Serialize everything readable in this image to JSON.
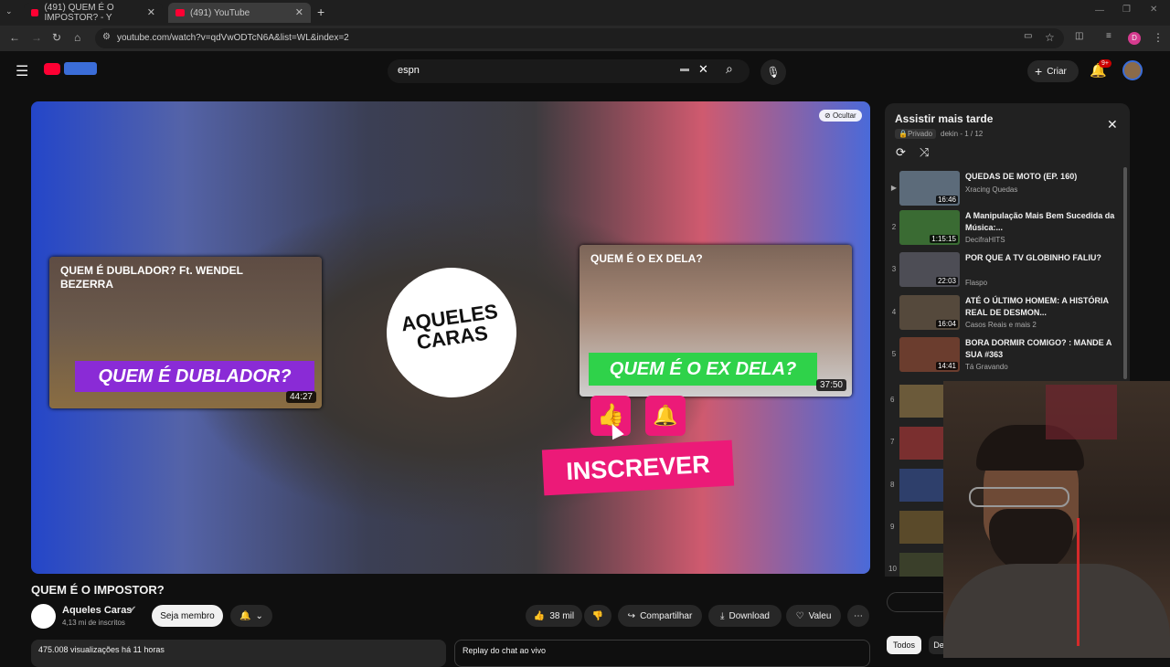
{
  "browser": {
    "tabs": [
      {
        "label": "(491) QUEM É O IMPOSTOR? - Y"
      },
      {
        "label": "(491) YouTube"
      }
    ],
    "url": "youtube.com/watch?v=qdVwODTcN6A&list=WL&index=2"
  },
  "header": {
    "search_value": "espn",
    "create_label": "Criar",
    "notification_badge": "9+",
    "profile_initial": "D"
  },
  "video": {
    "hide_label": "Ocultar",
    "endcards": [
      {
        "title": "QUEM É DUBLADOR? Ft. WENDEL BEZERRA",
        "banner": "QUEM É DUBLADOR?",
        "duration": "44:27"
      },
      {
        "title": "QUEM É O EX DELA?",
        "banner": "QUEM É O EX DELA?",
        "duration": "37:50"
      }
    ],
    "channel_logo_text": "AQUELES CARAS",
    "subscribe_overlay": "INSCREVER",
    "title": "QUEM É O IMPOSTOR?"
  },
  "channel": {
    "name": "Aqueles Caras",
    "subs": "4,13 mi de inscritos",
    "join_label": "Seja membro"
  },
  "actions": {
    "likes": "38 mil",
    "share": "Compartilhar",
    "download": "Download",
    "thanks": "Valeu"
  },
  "meta": {
    "views": "475.008 visualizações  há 11 horas",
    "chat_replay": "Replay do chat ao vivo"
  },
  "playlist": {
    "title": "Assistir mais tarde",
    "privacy": "Privado",
    "owner_pos": "dekin - 1 / 12",
    "items": [
      {
        "num": "▶",
        "title": "QUEDAS DE MOTO (EP. 160)",
        "channel": "Xracing Quedas",
        "duration": "16:46",
        "color": "#5c6b7a"
      },
      {
        "num": "2",
        "title": "A Manipulação Mais Bem Sucedida da Música:...",
        "channel": "DecifraHITS",
        "duration": "1:15:15",
        "color": "#3a6b33"
      },
      {
        "num": "3",
        "title": "POR QUE A TV GLOBINHO FALIU?",
        "channel": "Flaspo",
        "duration": "22:03",
        "color": "#4d4d55"
      },
      {
        "num": "4",
        "title": "ATÉ O ÚLTIMO HOMEM: A HISTÓRIA REAL DE DESMON...",
        "channel": "Casos Reais e mais 2",
        "duration": "16:04",
        "color": "#55493c"
      },
      {
        "num": "5",
        "title": "BORA DORMIR COMIGO? : MANDE A SUA #363",
        "channel": "Tá Gravando",
        "duration": "14:41",
        "color": "#6b3d2e"
      }
    ],
    "more_numbers": [
      "6",
      "7",
      "8",
      "9",
      "10"
    ]
  },
  "chips": {
    "all": "Todos",
    "partial": "De"
  }
}
